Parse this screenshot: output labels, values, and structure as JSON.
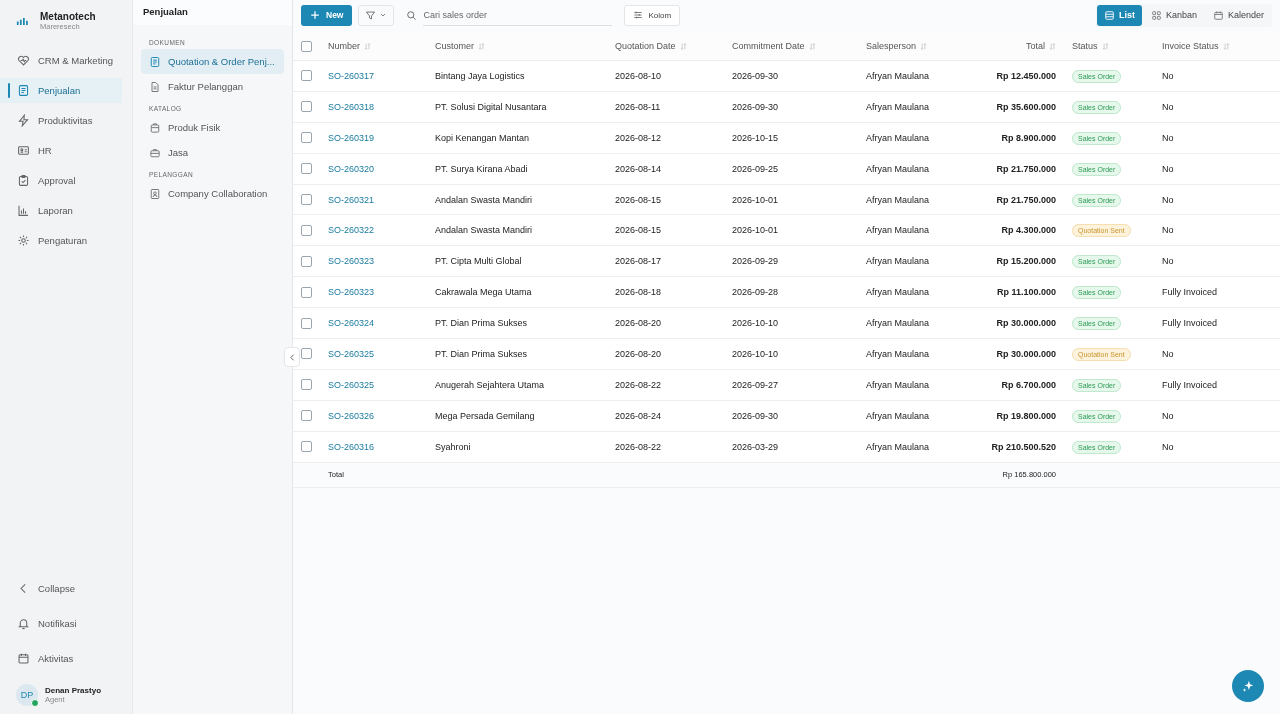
{
  "brand": {
    "name": "Metanotech",
    "subtitle": "Mareresech"
  },
  "nav": [
    {
      "label": "CRM & Marketing",
      "selected": false
    },
    {
      "label": "Penjualan",
      "selected": true
    },
    {
      "label": "Produktivitas",
      "selected": false
    },
    {
      "label": "HR",
      "selected": false
    },
    {
      "label": "Approval",
      "selected": false
    },
    {
      "label": "Laporan",
      "selected": false
    },
    {
      "label": "Pengaturan",
      "selected": false
    }
  ],
  "nav_bottom": [
    {
      "label": "Collapse"
    },
    {
      "label": "Notifikasi"
    },
    {
      "label": "Aktivitas"
    }
  ],
  "user": {
    "initials": "DP",
    "name": "Denan Prastyo",
    "role": "Agent",
    "online": true
  },
  "subpanel": {
    "title": "Penjualan",
    "sections": [
      {
        "heading": "DOKUMEN",
        "items": [
          {
            "label": "Quotation & Order Penj...",
            "selected": true
          },
          {
            "label": "Faktur Pelanggan",
            "selected": false
          }
        ]
      },
      {
        "heading": "KATALOG",
        "items": [
          {
            "label": "Produk Fisik",
            "selected": false
          },
          {
            "label": "Jasa",
            "selected": false
          }
        ]
      },
      {
        "heading": "PELANGGAN",
        "items": [
          {
            "label": "Company Collaboration",
            "selected": false
          }
        ]
      }
    ]
  },
  "toolbar": {
    "new_button": "New",
    "search": {
      "placeholder": "Cari sales order"
    },
    "columns_button": "Kolom",
    "views": [
      {
        "label": "List",
        "selected": true
      },
      {
        "label": "Kanban",
        "selected": false
      },
      {
        "label": "Kalender",
        "selected": false
      }
    ]
  },
  "table": {
    "select_all": {
      "checked": false
    },
    "columns": [
      "Number",
      "Customer",
      "Quotation Date",
      "Commitment Date",
      "Salesperson",
      "Total",
      "Status",
      "Invoice Status"
    ],
    "rows": [
      {
        "checked": false,
        "number": "SO-260317",
        "customer": "Bintang Jaya Logistics",
        "quotation_date": "2026-08-10",
        "commitment_date": "2026-09-30",
        "salesperson": "Afryan Maulana",
        "total": "Rp 12.450.000",
        "status": {
          "label": "Sales Order",
          "kind": "order"
        },
        "invoice_status": "No"
      },
      {
        "checked": false,
        "number": "SO-260318",
        "customer": "PT. Solusi Digital Nusantara",
        "quotation_date": "2026-08-11",
        "commitment_date": "2026-09-30",
        "salesperson": "Afryan Maulana",
        "total": "Rp 35.600.000",
        "status": {
          "label": "Sales Order",
          "kind": "order"
        },
        "invoice_status": "No"
      },
      {
        "checked": false,
        "number": "SO-260319",
        "customer": "Kopi Kenangan Mantan",
        "quotation_date": "2026-08-12",
        "commitment_date": "2026-10-15",
        "salesperson": "Afryan Maulana",
        "total": "Rp 8.900.000",
        "status": {
          "label": "Sales Order",
          "kind": "order"
        },
        "invoice_status": "No"
      },
      {
        "checked": false,
        "number": "SO-260320",
        "customer": "PT. Surya Kirana Abadi",
        "quotation_date": "2026-08-14",
        "commitment_date": "2026-09-25",
        "salesperson": "Afryan Maulana",
        "total": "Rp 21.750.000",
        "status": {
          "label": "Sales Order",
          "kind": "order"
        },
        "invoice_status": "No"
      },
      {
        "checked": false,
        "number": "SO-260321",
        "customer": "Andalan Swasta Mandiri",
        "quotation_date": "2026-08-15",
        "commitment_date": "2026-10-01",
        "salesperson": "Afryan Maulana",
        "total": "Rp 21.750.000",
        "status": {
          "label": "Sales Order",
          "kind": "order"
        },
        "invoice_status": "No"
      },
      {
        "checked": false,
        "number": "SO-260322",
        "customer": "Andalan Swasta Mandiri",
        "quotation_date": "2026-08-15",
        "commitment_date": "2026-10-01",
        "salesperson": "Afryan Maulana",
        "total": "Rp 4.300.000",
        "status": {
          "label": "Quotation Sent",
          "kind": "quotation"
        },
        "invoice_status": "No"
      },
      {
        "checked": false,
        "number": "SO-260323",
        "customer": "PT. Cipta Multi Global",
        "quotation_date": "2026-08-17",
        "commitment_date": "2026-09-29",
        "salesperson": "Afryan Maulana",
        "total": "Rp 15.200.000",
        "status": {
          "label": "Sales Order",
          "kind": "order"
        },
        "invoice_status": "No"
      },
      {
        "checked": false,
        "number": "SO-260323",
        "customer": "Cakrawala Mega Utama",
        "quotation_date": "2026-08-18",
        "commitment_date": "2026-09-28",
        "salesperson": "Afryan Maulana",
        "total": "Rp 11.100.000",
        "status": {
          "label": "Sales Order",
          "kind": "order"
        },
        "invoice_status": "Fully Invoiced"
      },
      {
        "checked": false,
        "number": "SO-260324",
        "customer": "PT. Dian Prima Sukses",
        "quotation_date": "2026-08-20",
        "commitment_date": "2026-10-10",
        "salesperson": "Afryan Maulana",
        "total": "Rp 30.000.000",
        "status": {
          "label": "Sales Order",
          "kind": "order"
        },
        "invoice_status": "Fully Invoiced"
      },
      {
        "checked": false,
        "number": "SO-260325",
        "customer": "PT. Dian Prima Sukses",
        "quotation_date": "2026-08-20",
        "commitment_date": "2026-10-10",
        "salesperson": "Afryan Maulana",
        "total": "Rp 30.000.000",
        "status": {
          "label": "Quotation Sent",
          "kind": "quotation"
        },
        "invoice_status": "No"
      },
      {
        "checked": false,
        "number": "SO-260325",
        "customer": "Anugerah Sejahtera Utama",
        "quotation_date": "2026-08-22",
        "commitment_date": "2026-09-27",
        "salesperson": "Afryan Maulana",
        "total": "Rp 6.700.000",
        "status": {
          "label": "Sales Order",
          "kind": "order"
        },
        "invoice_status": "Fully Invoiced"
      },
      {
        "checked": false,
        "number": "SO-260326",
        "customer": "Mega Persada Gemilang",
        "quotation_date": "2026-08-24",
        "commitment_date": "2026-09-30",
        "salesperson": "Afryan Maulana",
        "total": "Rp 19.800.000",
        "status": {
          "label": "Sales Order",
          "kind": "order"
        },
        "invoice_status": "No"
      },
      {
        "checked": false,
        "number": "SO-260316",
        "customer": "Syahroni",
        "quotation_date": "2026-08-22",
        "commitment_date": "2026-03-29",
        "salesperson": "Afryan Maulana",
        "total": "Rp 210.500.520",
        "status": {
          "label": "Sales Order",
          "kind": "order"
        },
        "invoice_status": "No"
      }
    ],
    "footer": {
      "label": "Total",
      "total": "Rp 165.800.000"
    }
  }
}
